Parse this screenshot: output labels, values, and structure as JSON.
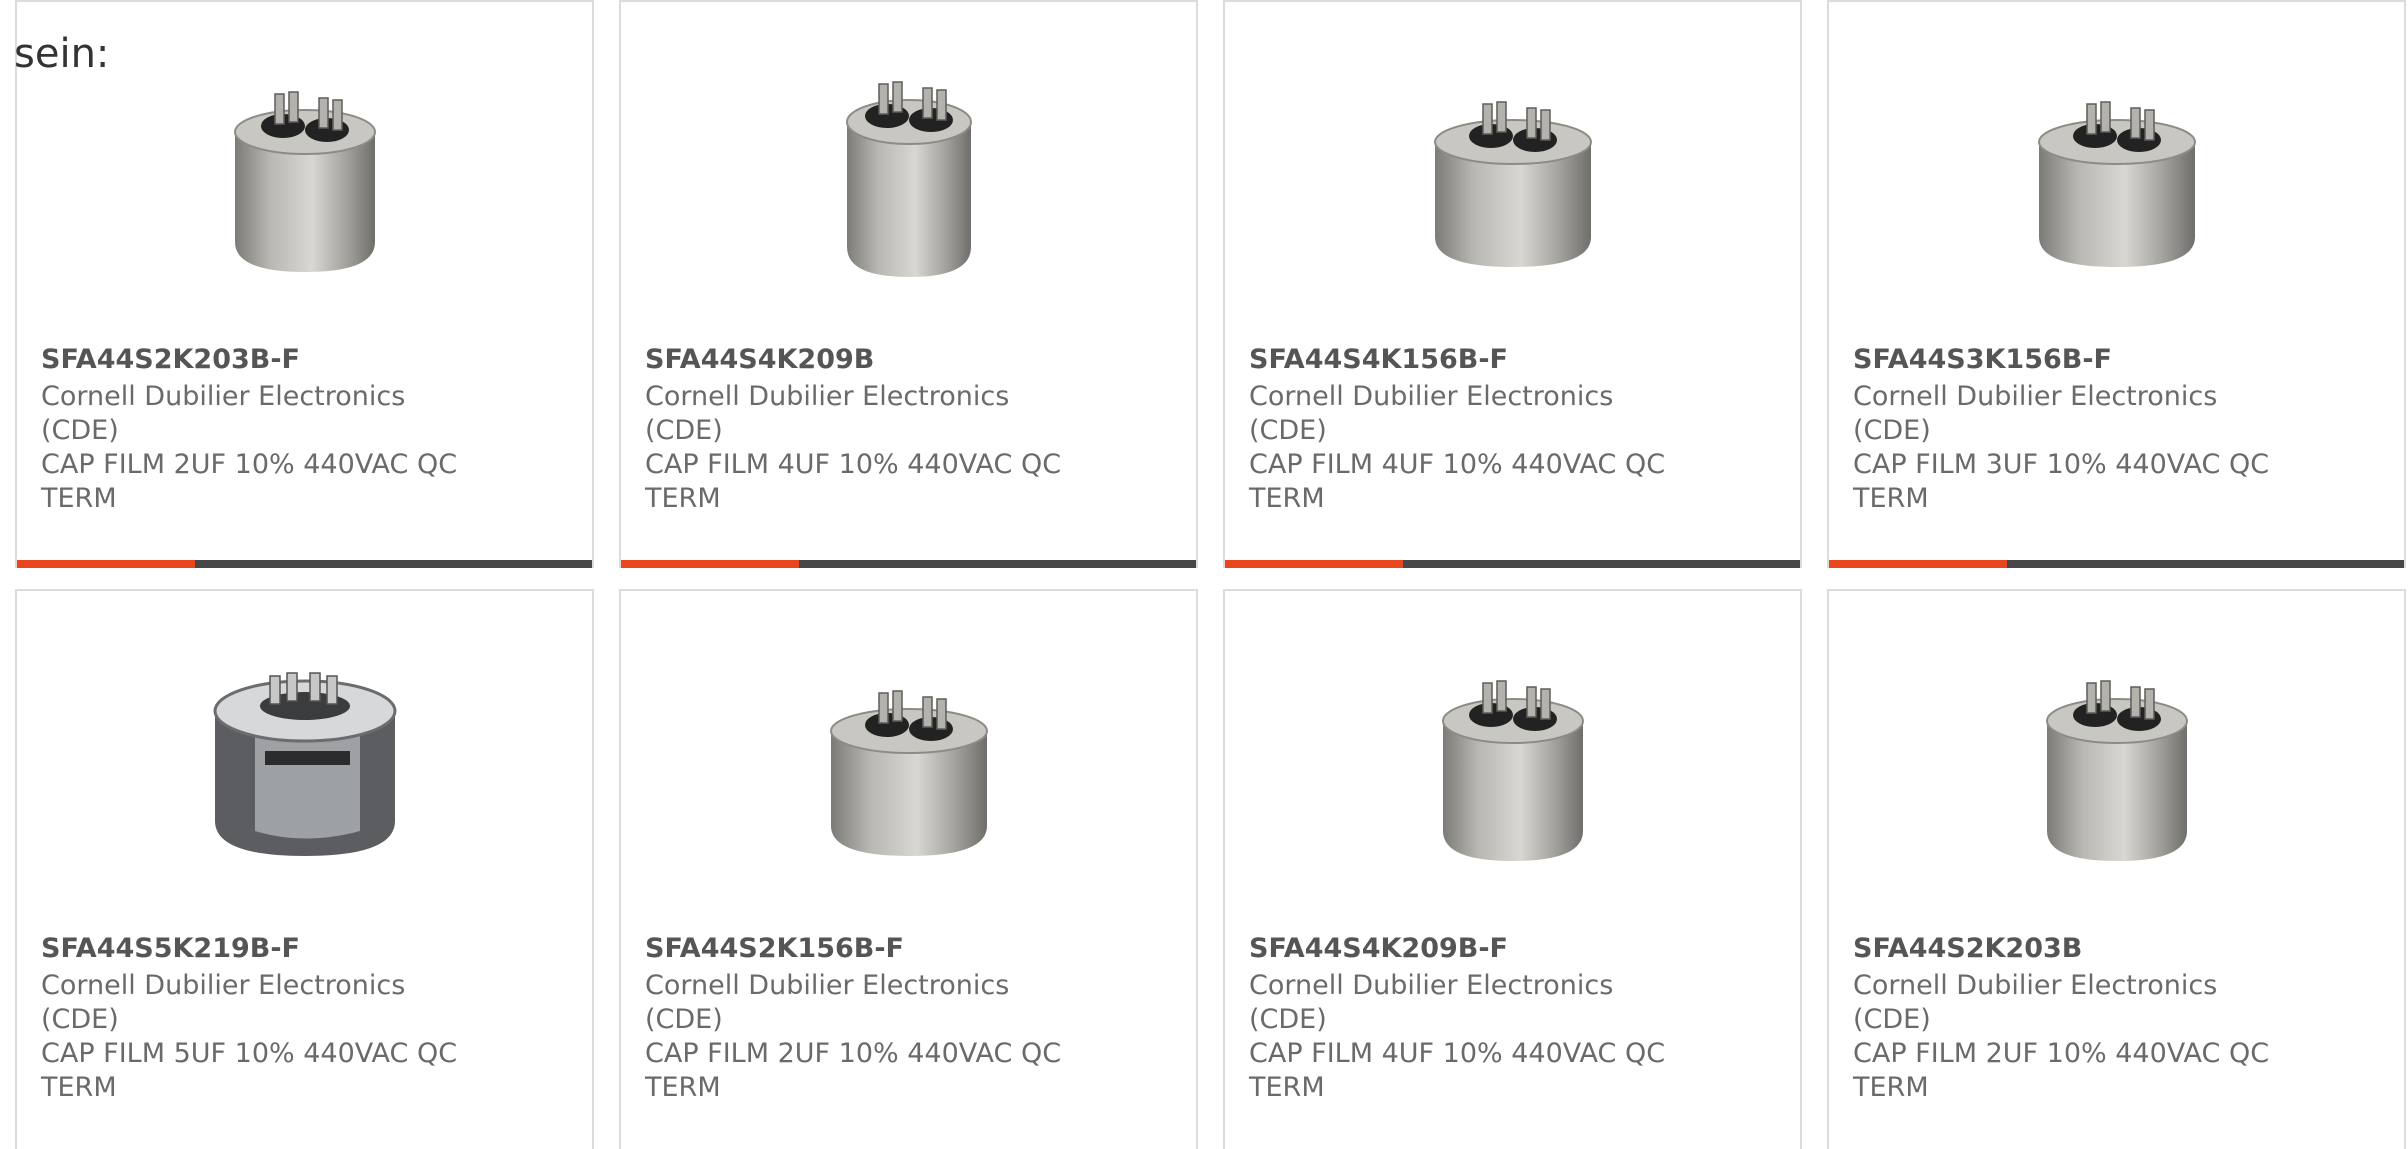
{
  "lead_text": "sein:",
  "accent_color": "#e8461e",
  "track_color": "#474747",
  "products": [
    {
      "part_number": "SFA44S2K203B-F",
      "manufacturer": "Cornell Dubilier Electronics (CDE)",
      "description": "CAP FILM 2UF 10% 440VAC QC TERM",
      "image_icon": "oval-capacitor-icon",
      "progress": 0.31
    },
    {
      "part_number": "SFA44S4K209B",
      "manufacturer": "Cornell Dubilier Electronics (CDE)",
      "description": "CAP FILM 4UF 10% 440VAC QC TERM",
      "image_icon": "oval-capacitor-icon",
      "progress": 0.31
    },
    {
      "part_number": "SFA44S4K156B-F",
      "manufacturer": "Cornell Dubilier Electronics (CDE)",
      "description": "CAP FILM 4UF 10% 440VAC QC TERM",
      "image_icon": "oval-capacitor-icon",
      "progress": 0.31
    },
    {
      "part_number": "SFA44S3K156B-F",
      "manufacturer": "Cornell Dubilier Electronics (CDE)",
      "description": "CAP FILM 3UF 10% 440VAC QC TERM",
      "image_icon": "oval-capacitor-icon",
      "progress": 0.31
    },
    {
      "part_number": "SFA44S5K219B-F",
      "manufacturer": "Cornell Dubilier Electronics (CDE)",
      "description": "CAP FILM 5UF 10% 440VAC QC TERM",
      "image_icon": "round-capacitor-icon",
      "progress": null
    },
    {
      "part_number": "SFA44S2K156B-F",
      "manufacturer": "Cornell Dubilier Electronics (CDE)",
      "description": "CAP FILM 2UF 10% 440VAC QC TERM",
      "image_icon": "oval-capacitor-icon",
      "progress": null
    },
    {
      "part_number": "SFA44S4K209B-F",
      "manufacturer": "Cornell Dubilier Electronics (CDE)",
      "description": "CAP FILM 4UF 10% 440VAC QC TERM",
      "image_icon": "oval-capacitor-icon",
      "progress": null
    },
    {
      "part_number": "SFA44S2K203B",
      "manufacturer": "Cornell Dubilier Electronics (CDE)",
      "description": "CAP FILM 2UF 10% 440VAC QC TERM",
      "image_icon": "oval-capacitor-icon",
      "progress": null
    }
  ]
}
